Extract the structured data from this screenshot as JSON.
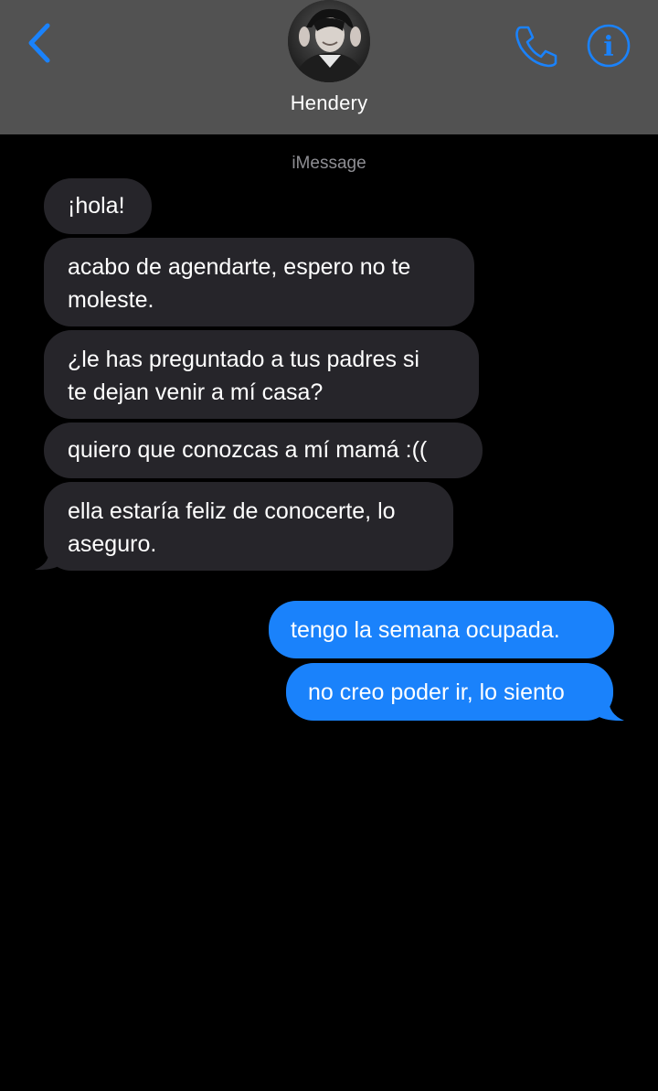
{
  "header": {
    "contact_name": "Hendery",
    "back_icon": "chevron-left-icon",
    "call_icon": "phone-icon",
    "info_icon": "info-icon",
    "accent_color": "#1a82fb",
    "background_color": "#525252"
  },
  "conversation": {
    "service_label": "iMessage",
    "incoming_color": "#26252a",
    "outgoing_color": "#1a82fb",
    "incoming": [
      {
        "lines": [
          "¡hola!"
        ]
      },
      {
        "lines": [
          "acabo de agendarte, espero no te",
          "moleste."
        ]
      },
      {
        "lines": [
          "¿le has preguntado a tus padres si",
          "te dejan venir a mí casa?"
        ]
      },
      {
        "lines": [
          "quiero que conozcas a mí mamá :(("
        ]
      },
      {
        "lines": [
          "ella estaría feliz de conocerte, lo",
          "aseguro."
        ]
      }
    ],
    "outgoing": [
      {
        "lines": [
          "tengo la semana ocupada."
        ]
      },
      {
        "lines": [
          "no creo poder ir, lo siento"
        ]
      }
    ]
  }
}
